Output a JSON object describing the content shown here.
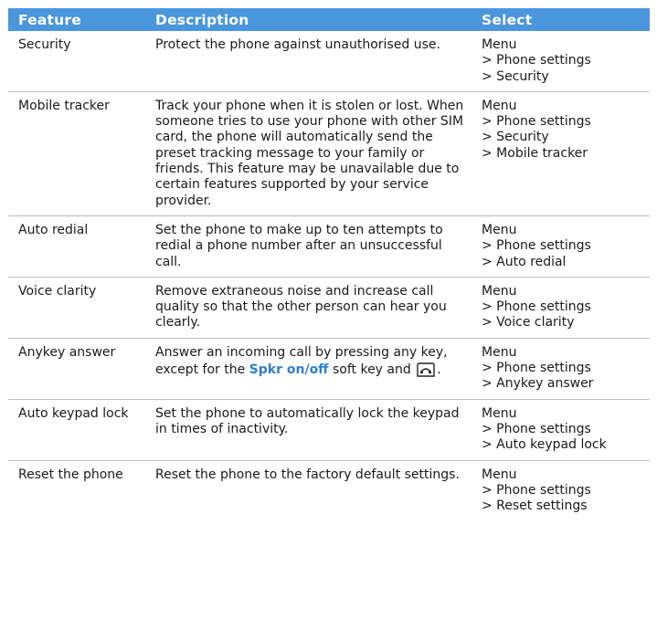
{
  "header": {
    "feature": "Feature",
    "description": "Description",
    "select": "Select"
  },
  "rows": [
    {
      "feature": "Security",
      "description": "Protect the phone against unauthorised use.",
      "path": [
        "Menu",
        "> Phone settings",
        "> Security"
      ]
    },
    {
      "feature": "Mobile tracker",
      "description": "Track your phone when it is stolen or lost. When someone tries to use your phone with other SIM card, the phone will automatically send the preset tracking message to your family or friends. This feature may be unavailable due to certain features supported by your service provider.",
      "path": [
        "Menu",
        "> Phone settings",
        "> Security",
        "> Mobile tracker"
      ]
    },
    {
      "feature": "Auto redial",
      "description": "Set the phone to make up to ten attempts to redial a phone number after an unsuccessful call.",
      "path": [
        "Menu",
        "> Phone settings",
        "> Auto redial"
      ]
    },
    {
      "feature": "Voice clarity",
      "description": "Remove extraneous noise and increase call quality so that the other person can hear you clearly.",
      "path": [
        "Menu",
        "> Phone settings",
        "> Voice clarity"
      ]
    },
    {
      "feature": "Anykey answer",
      "description_parts": {
        "before": "Answer an incoming call by pressing any key, except for the ",
        "keyword": "Spkr on/off",
        "after": " soft key and ",
        "end": "."
      },
      "path": [
        "Menu",
        "> Phone settings",
        "> Anykey answer"
      ]
    },
    {
      "feature": "Auto keypad lock",
      "description": "Set the phone to automatically lock the keypad in times of inactivity.",
      "path": [
        "Menu",
        "> Phone settings",
        "> Auto keypad lock"
      ]
    },
    {
      "feature": "Reset the phone",
      "description": "Reset the phone to the factory default settings.",
      "path": [
        "Menu",
        "> Phone settings",
        "> Reset settings"
      ]
    }
  ],
  "colors": {
    "header_bg": "#4a96dc",
    "keyword": "#2f7fd1"
  },
  "icons": {
    "end_key": "end-call-key-icon"
  }
}
